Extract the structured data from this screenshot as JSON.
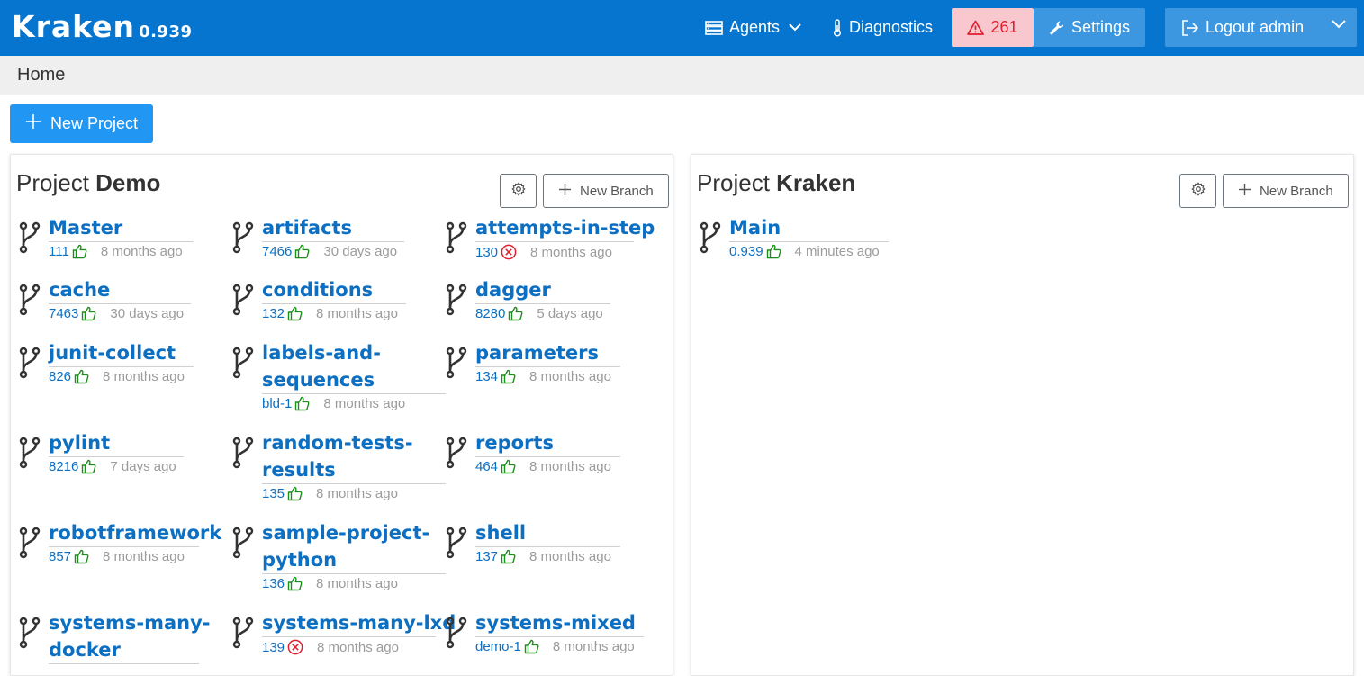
{
  "app": {
    "name": "Kraken",
    "version": "0.939"
  },
  "nav": {
    "agents_label": "Agents",
    "diagnostics_label": "Diagnostics",
    "alerts_count": "261",
    "settings_label": "Settings",
    "logout_label": "Logout admin"
  },
  "breadcrumb": {
    "home": "Home"
  },
  "toolbar": {
    "new_project_label": "New Project"
  },
  "colors": {
    "topbar": "#0575cf",
    "link": "#0d6fc2",
    "success": "#1a8f1a",
    "error": "#e01e2e",
    "alert_bg": "#f8c8ce"
  },
  "projects": [
    {
      "prefix": "Project",
      "name": "Demo",
      "new_branch_label": "New Branch",
      "branches": [
        {
          "name": "Master",
          "build": "111",
          "status": "success",
          "time": "8 months ago"
        },
        {
          "name": "artifacts",
          "build": "7466",
          "status": "success",
          "time": "30 days ago"
        },
        {
          "name": "attempts-in-step",
          "build": "130",
          "status": "error",
          "time": "8 months ago"
        },
        {
          "name": "cache",
          "build": "7463",
          "status": "success",
          "time": "30 days ago"
        },
        {
          "name": "conditions",
          "build": "132",
          "status": "success",
          "time": "8 months ago"
        },
        {
          "name": "dagger",
          "build": "8280",
          "status": "success",
          "time": "5 days ago"
        },
        {
          "name": "junit-collect",
          "build": "826",
          "status": "success",
          "time": "8 months ago"
        },
        {
          "name": "labels-and-sequences",
          "line1": "labels-and-",
          "line2": "sequences",
          "build": "bld-1",
          "status": "success",
          "time": "8 months ago"
        },
        {
          "name": "parameters",
          "build": "134",
          "status": "success",
          "time": "8 months ago"
        },
        {
          "name": "pylint",
          "build": "8216",
          "status": "success",
          "time": "7 days ago"
        },
        {
          "name": "random-tests-results",
          "line1": "random-tests-",
          "line2": "results",
          "build": "135",
          "status": "success",
          "time": "8 months ago"
        },
        {
          "name": "reports",
          "build": "464",
          "status": "success",
          "time": "8 months ago"
        },
        {
          "name": "robotframework",
          "build": "857",
          "status": "success",
          "time": "8 months ago"
        },
        {
          "name": "sample-project-python",
          "line1": "sample-project-",
          "line2": "python",
          "build": "136",
          "status": "success",
          "time": "8 months ago"
        },
        {
          "name": "shell",
          "build": "137",
          "status": "success",
          "time": "8 months ago"
        },
        {
          "name": "systems-many-docker",
          "line1": "systems-many-",
          "line2": "docker",
          "build": "",
          "status": "",
          "time": ""
        },
        {
          "name": "systems-many-lxd",
          "build": "139",
          "status": "error",
          "time": "8 months ago"
        },
        {
          "name": "systems-mixed",
          "build": "demo-1",
          "status": "success",
          "time": "8 months ago"
        }
      ]
    },
    {
      "prefix": "Project",
      "name": "Kraken",
      "new_branch_label": "New Branch",
      "branches": [
        {
          "name": "Main",
          "build": "0.939",
          "status": "success",
          "time": "4 minutes ago"
        }
      ]
    }
  ]
}
